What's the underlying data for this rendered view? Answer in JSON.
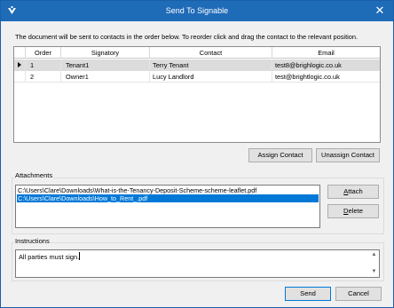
{
  "window": {
    "title": "Send To Signable",
    "close_glyph": "✕"
  },
  "info_text": "The document will be sent to contacts in the order below. To reorder click and drag the contact to the relevant position.",
  "grid": {
    "columns": [
      "Order",
      "Signatory",
      "Contact",
      "Email"
    ],
    "rows": [
      {
        "order": "1",
        "signatory": "Tenant1",
        "contact": "Terry Tenant",
        "email": "test8@brighlogic.co.uk",
        "selected": true
      },
      {
        "order": "2",
        "signatory": "Owner1",
        "contact": "Lucy Landlord",
        "email": "test@brightlogic.co.uk",
        "selected": false
      }
    ]
  },
  "buttons": {
    "assign": "Assign Contact",
    "unassign": "Unassign Contact",
    "attach_first": "A",
    "attach_rest": "ttach",
    "delete_first": "D",
    "delete_rest": "elete",
    "send": "Send",
    "cancel": "Cancel"
  },
  "attachments": {
    "label": "Attachments",
    "items": [
      {
        "path": "C:\\Users\\Clare\\Downloads\\What-is-the-Tenancy-Deposit-Scheme-scheme-leaflet.pdf",
        "selected": false
      },
      {
        "path": "C:\\Users\\Clare\\Downloads\\How_to_Rent_.pdf",
        "selected": true
      }
    ]
  },
  "instructions": {
    "label": "Instructions",
    "value": "All parties must sign."
  },
  "colors": {
    "titlebar": "#1e6bb8",
    "selection": "#0078d7"
  },
  "icons": [
    "app-logo-icon",
    "close-icon",
    "row-indicator-icon",
    "scroll-up-icon",
    "scroll-down-icon"
  ]
}
